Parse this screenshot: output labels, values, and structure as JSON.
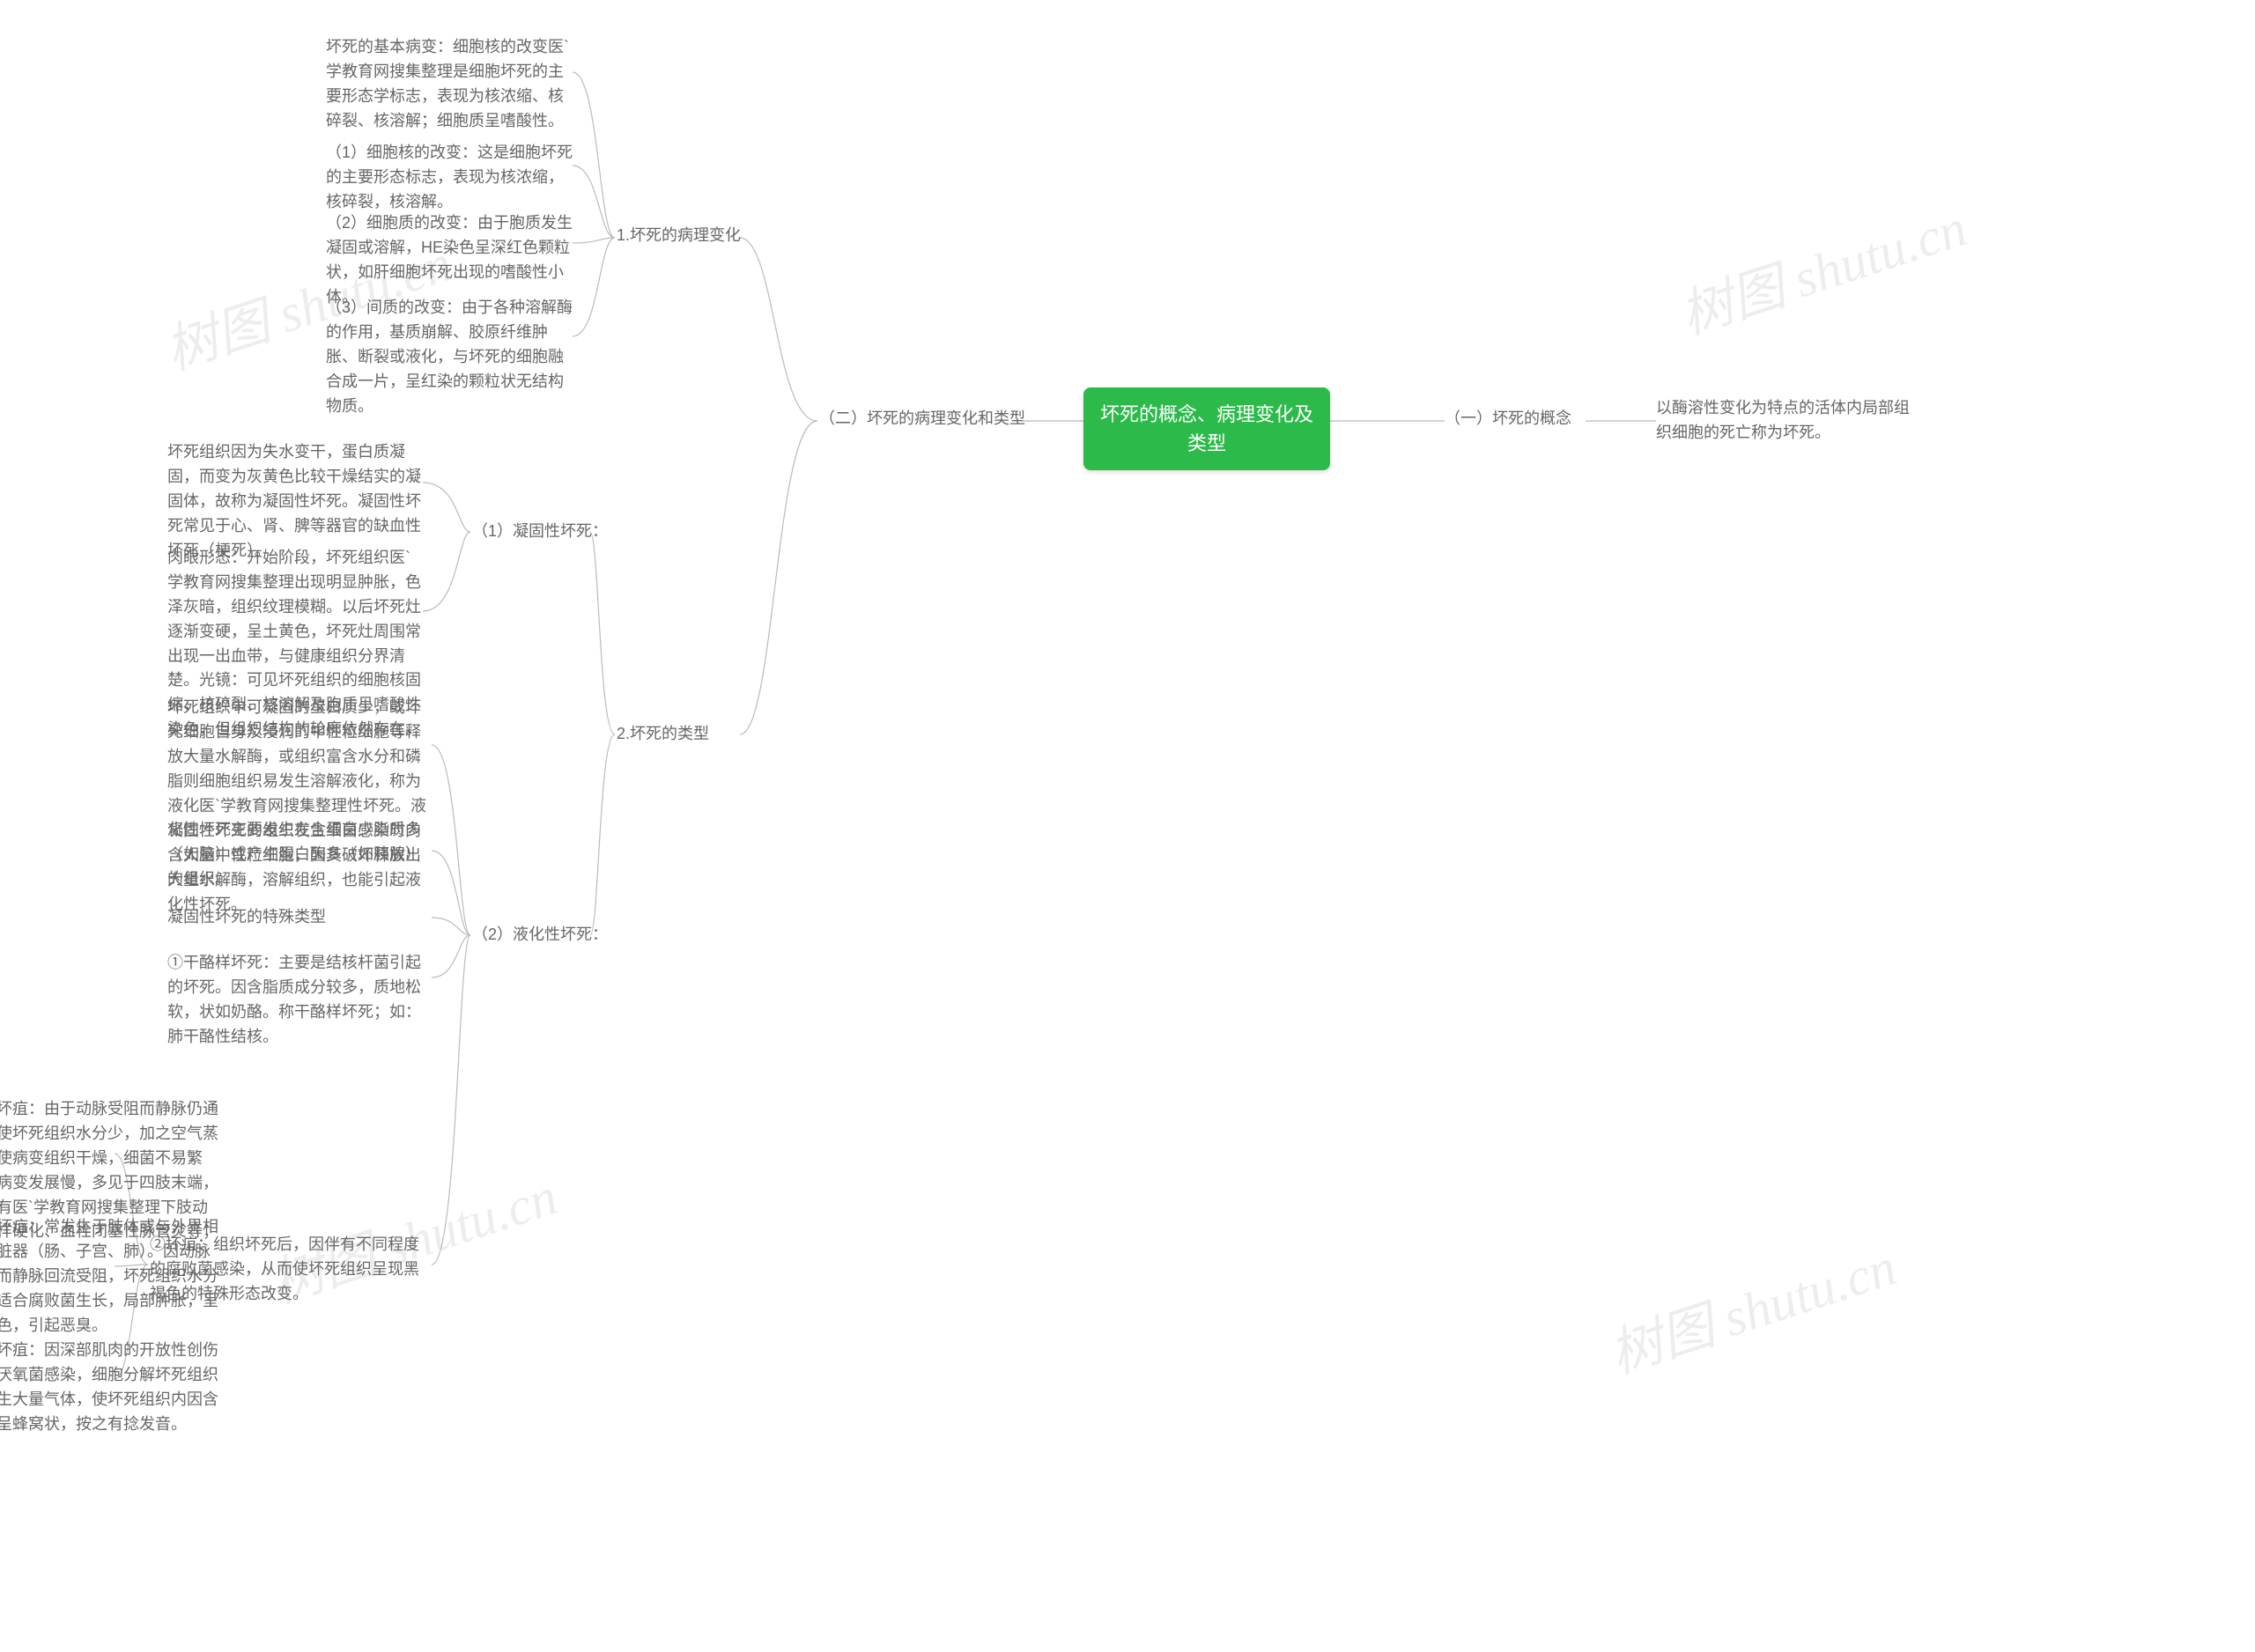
{
  "watermark": "树图 shutu.cn",
  "root": "坏死的概念、病理变化及类型",
  "right": {
    "b1": "（一）坏死的概念",
    "b2": "以酶溶性变化为特点的活体内局部组织细胞的死亡称为坏死。"
  },
  "left": {
    "b1": "（二）坏死的病理变化和类型",
    "pathology": {
      "title": "1.坏死的病理变化",
      "items": {
        "a": "坏死的基本病变：细胞核的改变医`学教育网搜集整理是细胞坏死的主要形态学标志，表现为核浓缩、核碎裂、核溶解；细胞质呈嗜酸性。",
        "b": "（1）细胞核的改变：这是细胞坏死的主要形态标志，表现为核浓缩，核碎裂，核溶解。",
        "c": "（2）细胞质的改变：由于胞质发生凝固或溶解，HE染色呈深红色颗粒状，如肝细胞坏死出现的嗜酸性小体。",
        "d": "（3）间质的改变：由于各种溶解酶的作用，基质崩解、胶原纤维肿胀、断裂或液化，与坏死的细胞融合成一片，呈红染的颗粒状无结构物质。"
      }
    },
    "types": {
      "title": "2.坏死的类型",
      "coag": {
        "title": "（1）凝固性坏死：",
        "a": "坏死组织因为失水变干，蛋白质凝固，而变为灰黄色比较干燥结实的凝固体，故称为凝固性坏死。凝固性坏死常见于心、肾、脾等器官的缺血性坏死（梗死）。",
        "b": "肉眼形态：开始阶段，坏死组织医`学教育网搜集整理出现明显肿胀，色泽灰暗，组织纹理模糊。以后坏死灶逐渐变硬，呈土黄色，坏死灶周围常出现一出血带，与健康组织分界清楚。光镜：可见坏死组织的细胞核固缩、核碎裂、核溶解及胞质呈嗜酸性染色，但组织结构的轮廓依然存在。"
      },
      "liq": {
        "title": "（2）液化性坏死：",
        "a": "坏死组织中可凝固的蛋白质少，或坏死细胞自身及浸润的中性粒细胞等释放大量水解酶，或组织富含水分和磷脂则细胞组织易发生溶解液化，称为液化医`学教育网搜集整理性坏死。液化性坏死主要发生在含蛋白少脂质多（如脑）或产生蛋白酶多（如胰腺）的组织。",
        "b": "凝固性坏死的组织发生细菌感染时内含大量中性粒细胞，因其破坏释放出大量水解酶，溶解组织，也能引起液化性坏死。",
        "c": "凝固性坏死的特殊类型",
        "d": "①干酪样坏死：主要是结核杆菌引起的坏死。因含脂质成分较多，质地松软，状如奶酪。称干酪样坏死；如：肺干酪性结核。",
        "e": "②坏疽：组织坏死后，因伴有不同程度的腐败菌感染，从而使坏死组织呈现黑褐色的特殊形态改变。",
        "gangrene": {
          "a": "干性坏疽：由于动脉受阻而静脉仍通畅，使坏死组织水分少，加之空气蒸发，使病变组织干燥，细菌不易繁殖，病变发展慢，多见于四肢末端，原因有医`学教育网搜集整理下肢动脉粥样硬化、血栓闭塞性脉管炎等；",
          "b": "湿性坏疽：常发生于肢体或与外界相通的脏器（肠、子宫、肺）。因动脉闭塞而静脉回流受阻，坏死组织水分多，适合腐败菌生长，局部肿胀，呈污黑色，引起恶臭。",
          "c": "气性坏疽：因深部肌肉的开放性创伤合并厌氧菌感染，细胞分解坏死组织并产生大量气体，使坏死组织内因含气泡呈蜂窝状，按之有捻发音。"
        }
      }
    }
  }
}
